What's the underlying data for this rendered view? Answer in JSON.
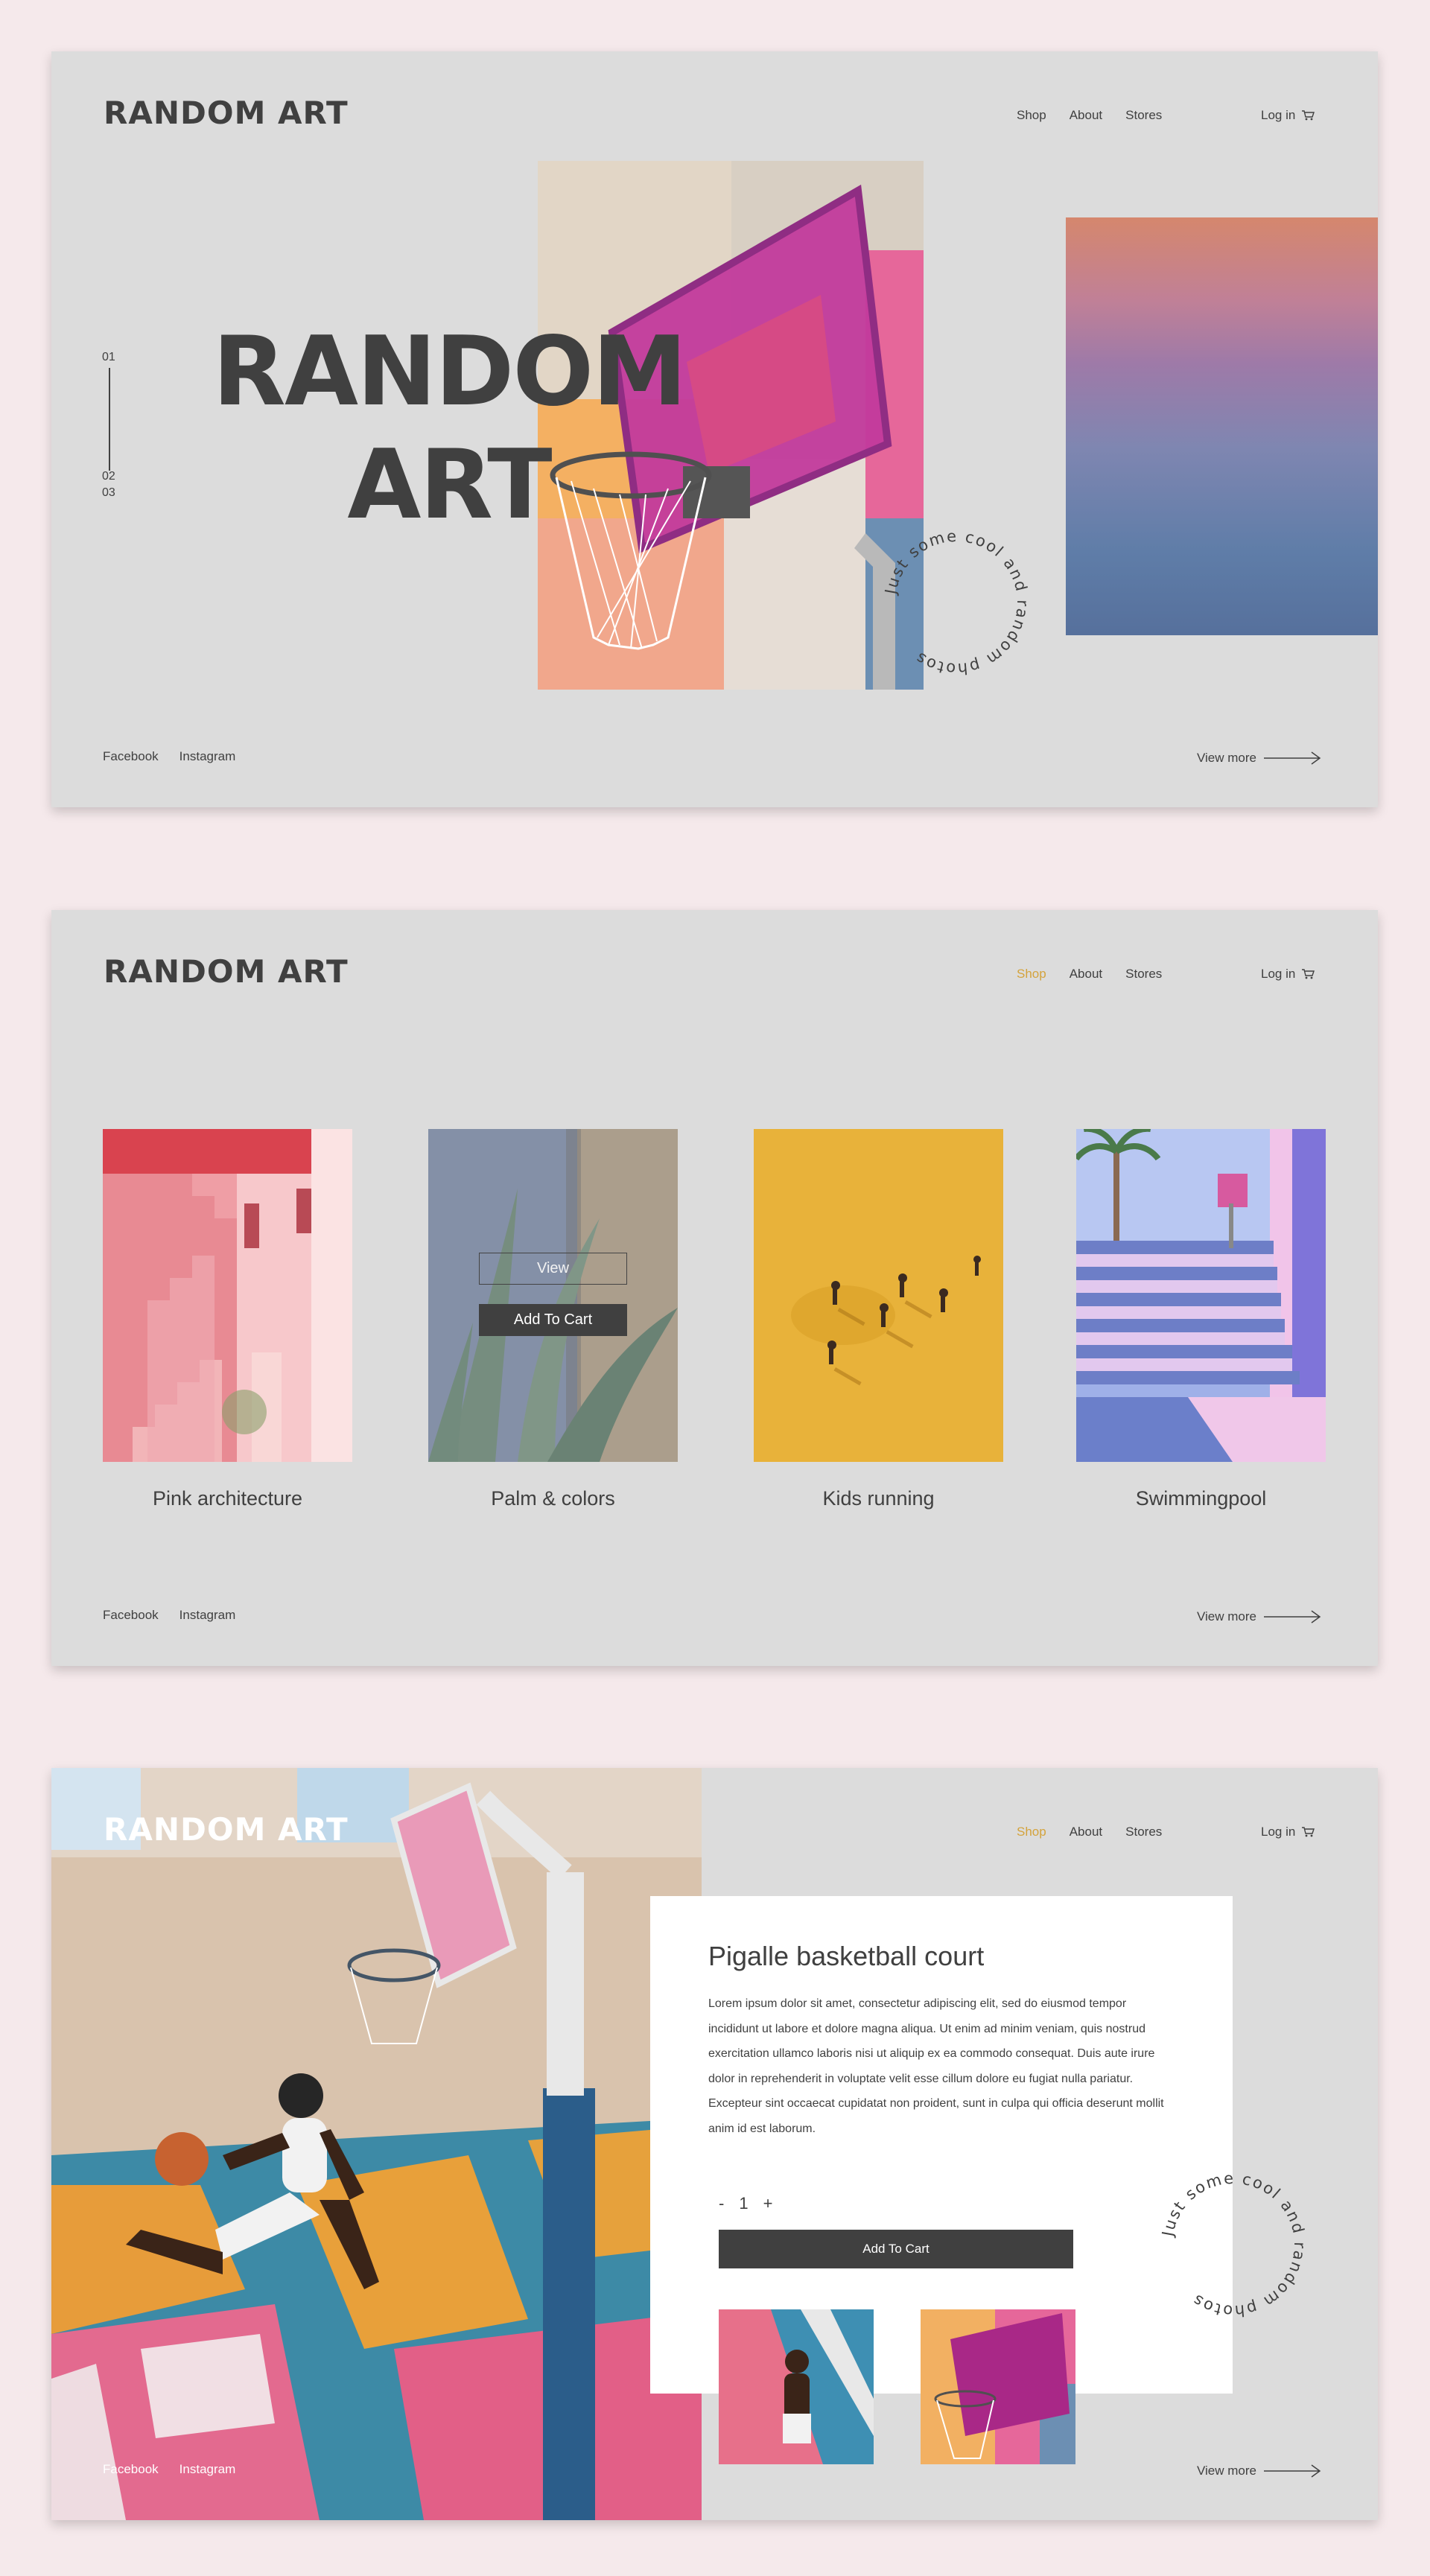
{
  "brand": "RANDOM ART",
  "nav": {
    "shop": "Shop",
    "about": "About",
    "stores": "Stores",
    "login": "Log in"
  },
  "footer": {
    "facebook": "Facebook",
    "instagram": "Instagram",
    "view_more": "View more"
  },
  "colors": {
    "background": "#f5e9eb",
    "panel": "#dcdcdc",
    "text": "#404040",
    "accent": "#d4a33c"
  },
  "hero": {
    "slide_numbers": [
      "01",
      "02",
      "03"
    ],
    "title_line1": "RANDOM",
    "title_line2": "ART",
    "circle_text": "Just some cool and random photos"
  },
  "shop": {
    "products": [
      {
        "name": "Pink architecture"
      },
      {
        "name": "Palm & colors",
        "view_label": "View",
        "cart_label": "Add To Cart"
      },
      {
        "name": "Kids running"
      },
      {
        "name": "Swimmingpool"
      }
    ]
  },
  "product_detail": {
    "title": "Pigalle basketball court",
    "description": "Lorem ipsum dolor sit amet, consectetur adipiscing elit, sed do eiusmod tempor incididunt ut labore et dolore magna aliqua. Ut enim ad minim veniam, quis nostrud exercitation ullamco laboris nisi ut aliquip ex ea commodo consequat. Duis aute irure dolor in reprehenderit in voluptate velit esse cillum dolore eu fugiat nulla pariatur. Excepteur sint occaecat cupidatat non proident, sunt in culpa qui officia deserunt mollit anim id est laborum.",
    "qty_minus": "-",
    "quantity": "1",
    "qty_plus": "+",
    "add_to_cart": "Add To Cart"
  }
}
